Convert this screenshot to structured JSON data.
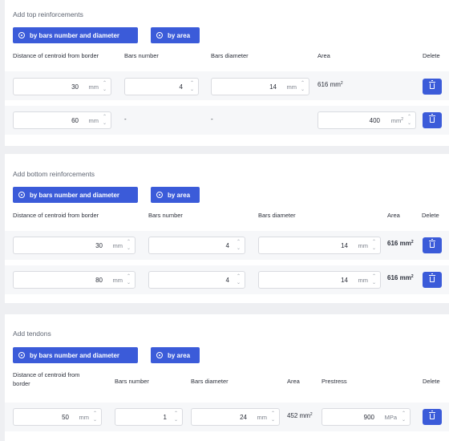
{
  "buttons": {
    "by_bars": "by bars number and diameter",
    "by_area": "by area"
  },
  "headers": {
    "distance": "Distance of centroid from border",
    "bars_number": "Bars number",
    "bars_diameter": "Bars diameter",
    "area": "Area",
    "prestress": "Prestress",
    "delete": "Delete"
  },
  "units": {
    "mm": "mm",
    "mm2": "mm",
    "mpa": "MPa"
  },
  "dash": "-",
  "top": {
    "title": "Add top reinforcements",
    "rows": [
      {
        "distance": "30",
        "bars_number": "4",
        "bars_diameter": "14",
        "area_text": "616"
      },
      {
        "distance": "60",
        "area_input": "400"
      }
    ]
  },
  "bottom": {
    "title": "Add bottom reinforcements",
    "rows": [
      {
        "distance": "30",
        "bars_number": "4",
        "bars_diameter": "14",
        "area_text": "616"
      },
      {
        "distance": "80",
        "bars_number": "4",
        "bars_diameter": "14",
        "area_text": "616"
      }
    ]
  },
  "tendons": {
    "title": "Add tendons",
    "rows": [
      {
        "distance": "50",
        "bars_number": "1",
        "bars_diameter": "24",
        "area_text": "452",
        "prestress": "900"
      }
    ]
  },
  "colors": {
    "accent": "#3b5bd9",
    "panel": "#ffffff",
    "row": "#f6f7f9",
    "page": "#eeeff2"
  }
}
